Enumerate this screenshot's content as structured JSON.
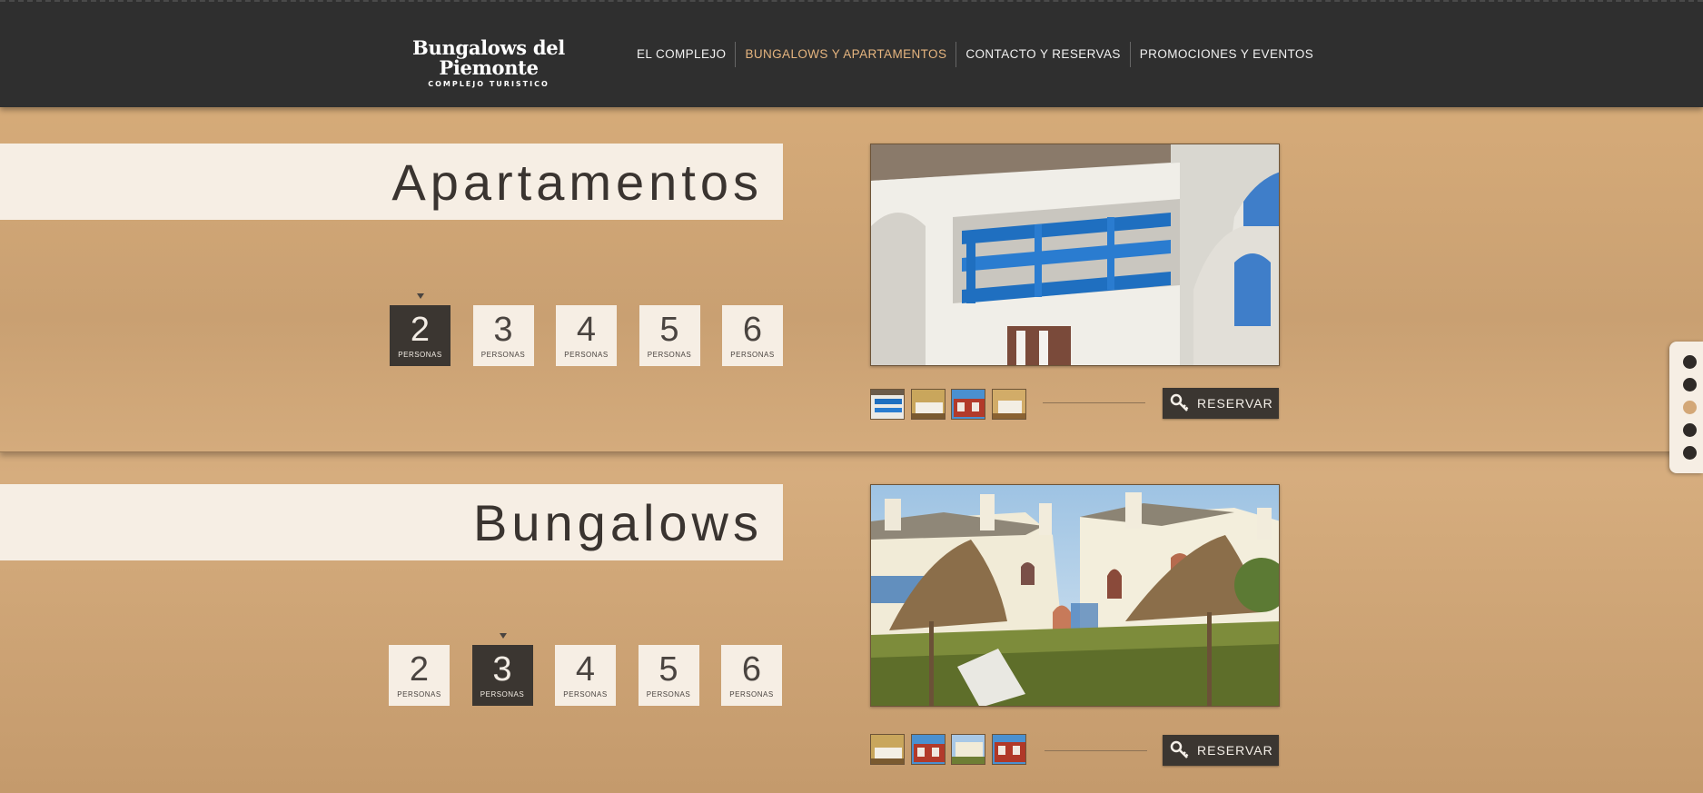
{
  "header": {
    "logo_title": "Bungalows del Piemonte",
    "logo_subtitle": "COMPLEJO TURISTICO",
    "nav": [
      {
        "label": "EL COMPLEJO",
        "active": false
      },
      {
        "label": "BUNGALOWS Y APARTAMENTOS",
        "active": true
      },
      {
        "label": "CONTACTO Y RESERVAS",
        "active": false
      },
      {
        "label": "PROMOCIONES Y EVENTOS",
        "active": false
      }
    ]
  },
  "sections": [
    {
      "title": "Apartamentos",
      "persons_label": "PERSONAS",
      "persons": [
        "2",
        "3",
        "4",
        "5",
        "6"
      ],
      "selected_persons_index": 0,
      "selected_thumb_index": 0,
      "reserve_label": "RESERVAR"
    },
    {
      "title": "Bungalows",
      "persons_label": "PERSONAS",
      "persons": [
        "2",
        "3",
        "4",
        "5",
        "6"
      ],
      "selected_persons_index": 1,
      "selected_thumb_index": 2,
      "reserve_label": "RESERVAR"
    }
  ],
  "side_nav": {
    "count": 5,
    "active_index": 2
  },
  "colors": {
    "header": "#2f2f2f",
    "accent": "#e6b57f",
    "panel": "#f6eee4",
    "dark": "#3b3631"
  }
}
